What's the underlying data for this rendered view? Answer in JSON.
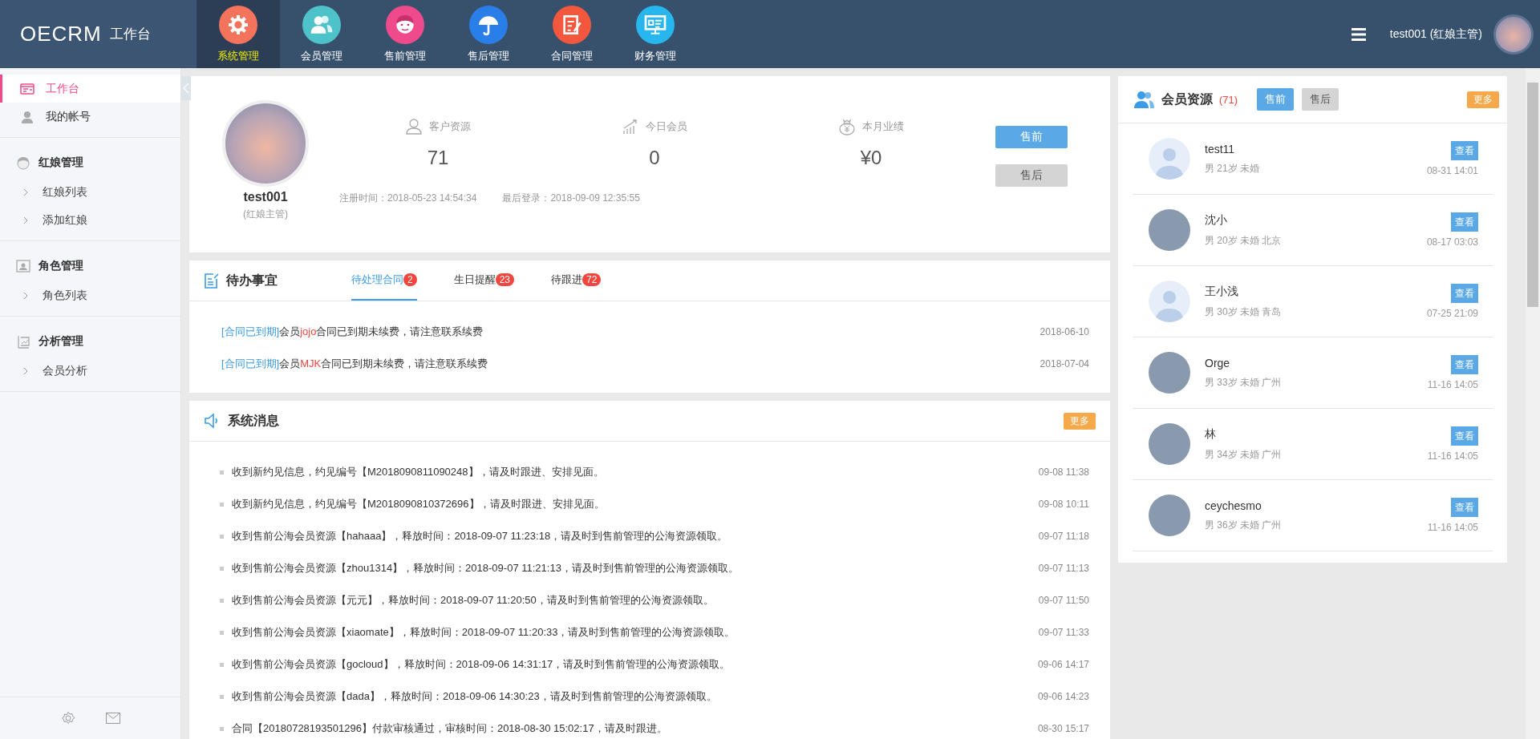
{
  "header": {
    "logo": "OECRM",
    "logo_sub": "工作台",
    "nav": [
      {
        "label": "系统管理",
        "kind": "gear",
        "color": "#f4735c",
        "selected": true
      },
      {
        "label": "会员管理",
        "kind": "users",
        "color": "#4ec2c9",
        "selected": false
      },
      {
        "label": "售前管理",
        "kind": "headset",
        "color": "#ee4a8c",
        "selected": false
      },
      {
        "label": "售后管理",
        "kind": "umbrella",
        "color": "#2a7ee8",
        "selected": false
      },
      {
        "label": "合同管理",
        "kind": "contract",
        "color": "#f3573e",
        "selected": false
      },
      {
        "label": "财务管理",
        "kind": "board",
        "color": "#27b7ee",
        "selected": false
      }
    ],
    "user": "test001 (红娘主管)"
  },
  "sidebar": {
    "items": [
      {
        "label": "工作台",
        "selected": true
      },
      {
        "label": "我的帐号",
        "selected": false
      }
    ],
    "groups": [
      {
        "title": "红娘管理",
        "items": [
          {
            "label": "红娘列表"
          },
          {
            "label": "添加红娘"
          }
        ]
      },
      {
        "title": "角色管理",
        "items": [
          {
            "label": "角色列表"
          }
        ]
      },
      {
        "title": "分析管理",
        "items": [
          {
            "label": "会员分析"
          }
        ]
      }
    ]
  },
  "profile": {
    "name": "test001",
    "role": "(红娘主管)",
    "stats": [
      {
        "kind": "person",
        "label": "客户资源",
        "value": "71"
      },
      {
        "kind": "chart",
        "label": "今日会员",
        "value": "0"
      },
      {
        "kind": "money",
        "label": "本月业绩",
        "value": "¥0"
      }
    ],
    "registered": "注册时间：2018-05-23 14:54:34",
    "last_login": "最后登录：2018-09-09 12:35:55",
    "buttons": [
      {
        "label": "售前",
        "selected": true
      },
      {
        "label": "售后",
        "selected": false
      }
    ]
  },
  "todo": {
    "title": "待办事宜",
    "tabs": [
      {
        "label": "待处理合同",
        "count": "2",
        "selected": true
      },
      {
        "label": "生日提醒",
        "count": "23",
        "selected": false
      },
      {
        "label": "待跟进",
        "count": "72",
        "selected": false
      }
    ],
    "items": [
      {
        "tag": "[合同已到期]",
        "before": "会员",
        "name": "jojo",
        "after": "合同已到期未续费，请注意联系续费",
        "date": "2018-06-10"
      },
      {
        "tag": "[合同已到期]",
        "before": "会员",
        "name": "MJK",
        "after": "合同已到期未续费，请注意联系续费",
        "date": "2018-07-04"
      }
    ]
  },
  "messages": {
    "title": "系统消息",
    "more": "更多",
    "items": [
      {
        "text": "收到新约见信息，约见编号【M2018090811090248】，请及时跟进、安排见面。",
        "time": "09-08 11:38"
      },
      {
        "text": "收到新约见信息，约见编号【M2018090810372696】，请及时跟进、安排见面。",
        "time": "09-08 10:11"
      },
      {
        "text": "收到售前公海会员资源【hahaaa】，释放时间：2018-09-07 11:23:18，请及时到售前管理的公海资源领取。",
        "time": "09-07 11:18"
      },
      {
        "text": "收到售前公海会员资源【zhou1314】，释放时间：2018-09-07 11:21:13，请及时到售前管理的公海资源领取。",
        "time": "09-07 11:13"
      },
      {
        "text": "收到售前公海会员资源【元元】，释放时间：2018-09-07 11:20:50，请及时到售前管理的公海资源领取。",
        "time": "09-07 11:50"
      },
      {
        "text": "收到售前公海会员资源【xiaomate】，释放时间：2018-09-07 11:20:33，请及时到售前管理的公海资源领取。",
        "time": "09-07 11:33"
      },
      {
        "text": "收到售前公海会员资源【gocloud】，释放时间：2018-09-06 14:31:17，请及时到售前管理的公海资源领取。",
        "time": "09-06 14:17"
      },
      {
        "text": "收到售前公海会员资源【dada】，释放时间：2018-09-06 14:30:23，请及时到售前管理的公海资源领取。",
        "time": "09-06 14:23"
      },
      {
        "text": "合同【20180728193501296】付款审核通过，审核时间：2018-08-30 15:02:17，请及时跟进。",
        "time": "08-30 15:17"
      }
    ]
  },
  "members": {
    "title": "会员资源",
    "count": "(71)",
    "tabs": [
      {
        "label": "售前",
        "selected": true
      },
      {
        "label": "售后",
        "selected": false
      }
    ],
    "more": "更多",
    "rows": [
      {
        "name": "test11",
        "info": "男 21岁 未婚",
        "time": "08-31 14:01",
        "action": "查看",
        "kind": "default"
      },
      {
        "name": "沈小",
        "info": "男 20岁 未婚 北京",
        "time": "08-17 03:03",
        "action": "查看",
        "kind": "photo"
      },
      {
        "name": "王小浅",
        "info": "男 30岁 未婚 青岛",
        "time": "07-25 21:09",
        "action": "查看",
        "kind": "default"
      },
      {
        "name": "Orge",
        "info": "男 33岁 未婚 广州",
        "time": "11-16 14:05",
        "action": "查看",
        "kind": "photo"
      },
      {
        "name": "林",
        "info": "男 34岁 未婚 广州",
        "time": "11-16 14:05",
        "action": "查看",
        "kind": "photo"
      },
      {
        "name": "ceychesmo",
        "info": "男 36岁 未婚 广州",
        "time": "11-16 14:05",
        "action": "查看",
        "kind": "photo"
      }
    ]
  }
}
